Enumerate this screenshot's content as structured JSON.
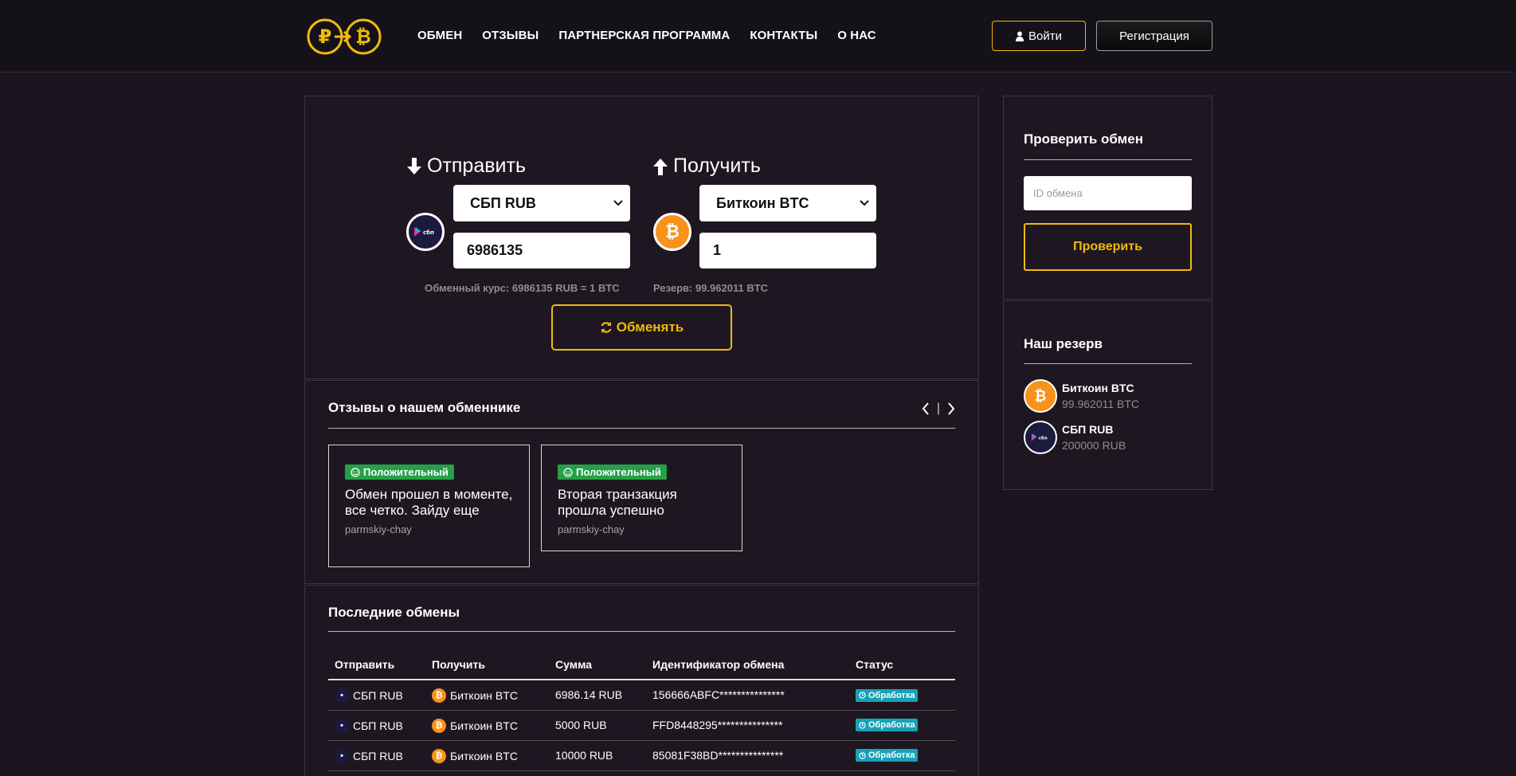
{
  "header": {
    "nav": [
      "ОБМЕН",
      "ОТЗЫВЫ",
      "ПАРТНЕРСКАЯ ПРОГРАММА",
      "КОНТАКТЫ",
      "О НАС"
    ],
    "login_label": "Войти",
    "register_label": "Регистрация"
  },
  "exchange": {
    "send_title": "Отправить",
    "receive_title": "Получить",
    "send_currency": "СБП RUB",
    "receive_currency": "Биткоин BTC",
    "send_amount": "6986135",
    "receive_amount": "1",
    "rate_note": "Обменный курс: 6986135 RUB = 1 BTC",
    "reserve_note": "Резерв: 99.962011 BTC",
    "button_label": "Обменять"
  },
  "reviews": {
    "title": "Отзывы о нашем обменнике",
    "items": [
      {
        "badge": "Положительный",
        "text": "Обмен прошел в моменте, все четко. Зайду еще",
        "author": "parmskiy-chay"
      },
      {
        "badge": "Положительный",
        "text": "Вторая транзакция прошла успешно",
        "author": "parmskiy-chay"
      }
    ]
  },
  "recent": {
    "title": "Последние обмены",
    "columns": [
      "Отправить",
      "Получить",
      "Сумма",
      "Идентификатор обмена",
      "Статус"
    ],
    "rows": [
      {
        "send": "СБП RUB",
        "receive": "Биткоин BTC",
        "amount": "6986.14 RUB",
        "id": "156666ABFC***************",
        "status": "Обработка"
      },
      {
        "send": "СБП RUB",
        "receive": "Биткоин BTC",
        "amount": "5000 RUB",
        "id": "FFD8448295***************",
        "status": "Обработка"
      },
      {
        "send": "СБП RUB",
        "receive": "Биткоин BTC",
        "amount": "10000 RUB",
        "id": "85081F38BD***************",
        "status": "Обработка"
      }
    ]
  },
  "check": {
    "title": "Проверить обмен",
    "placeholder": "ID обмена",
    "button_label": "Проверить"
  },
  "reserve": {
    "title": "Наш резерв",
    "items": [
      {
        "name": "Биткоин BTC",
        "value": "99.962011 BTC"
      },
      {
        "name": "СБП RUB",
        "value": "200000 RUB"
      }
    ]
  },
  "colors": {
    "accent": "#f0b90b",
    "background": "#1c1520",
    "header": "#141218",
    "btc": "#f7931a",
    "positive": "#24a148",
    "status": "#17a2b8"
  }
}
